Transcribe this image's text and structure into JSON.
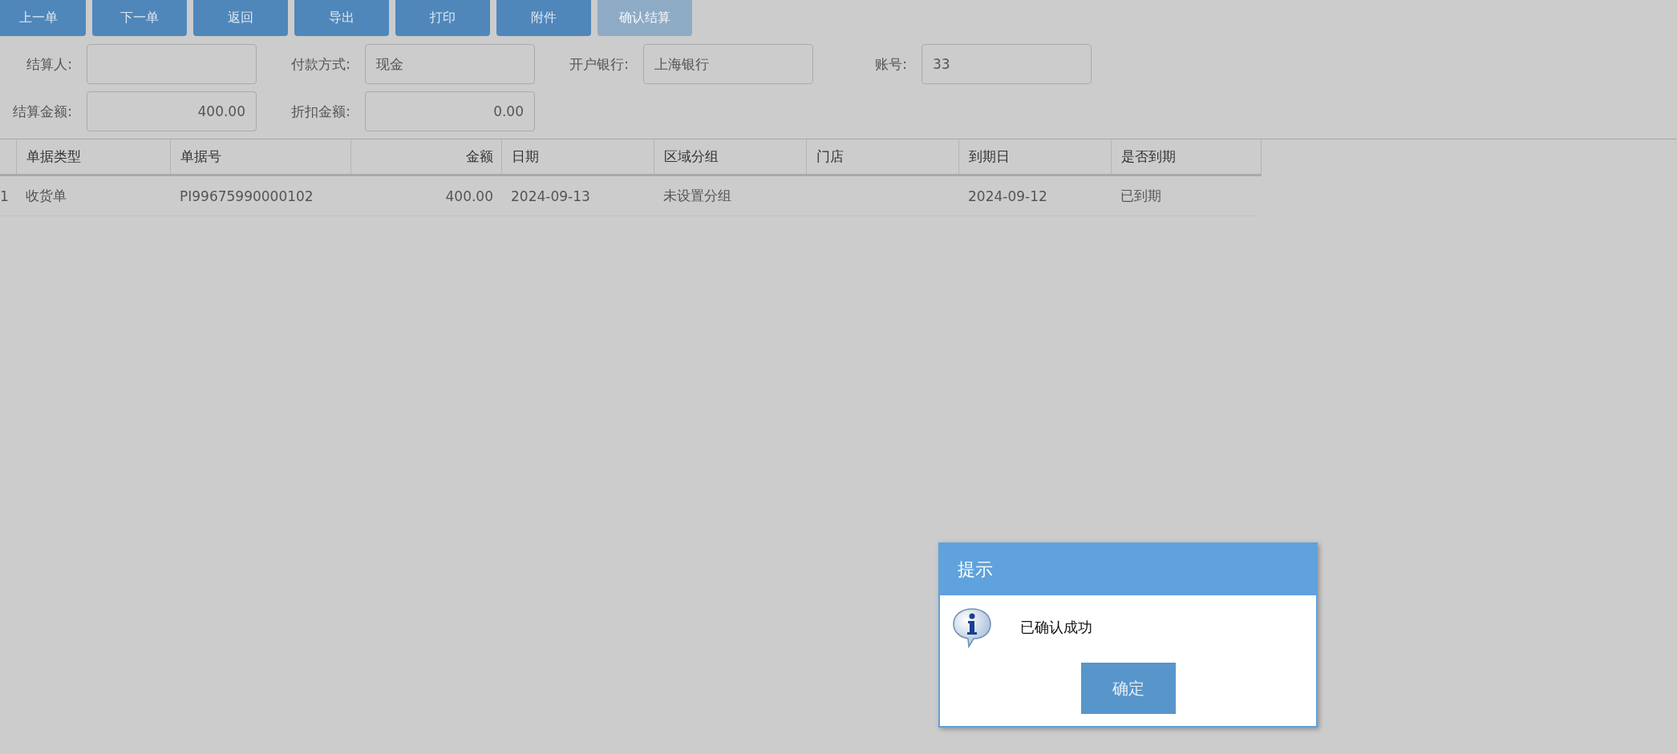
{
  "toolbar": [
    {
      "label": "上一单",
      "disabled": false
    },
    {
      "label": "下一单",
      "disabled": false
    },
    {
      "label": "返回",
      "disabled": false
    },
    {
      "label": "导出",
      "disabled": false
    },
    {
      "label": "打印",
      "disabled": false
    },
    {
      "label": "附件",
      "disabled": false
    },
    {
      "label": "确认结算",
      "disabled": true
    }
  ],
  "form_rows": [
    [
      {
        "label": "结算人:",
        "kind": "text"
      },
      {
        "label": "付款方式:",
        "value": "现金",
        "kind": "text"
      },
      {
        "label": "开户银行:",
        "value": "上海银行",
        "kind": "text"
      },
      {
        "label": "账号:",
        "value": "33",
        "kind": "text"
      }
    ],
    [
      {
        "label": "结算金额:",
        "value": "400.00",
        "kind": "amount"
      },
      {
        "label": "折扣金额:",
        "value": "0.00",
        "kind": "amount"
      }
    ]
  ],
  "table": {
    "columns": [
      {
        "kind": "index"
      },
      {
        "label": "单据类型",
        "kind": "text"
      },
      {
        "label": "单据号",
        "kind": "text"
      },
      {
        "label": "金额",
        "kind": "amount"
      },
      {
        "label": "日期",
        "kind": "text"
      },
      {
        "label": "区域分组",
        "kind": "text"
      },
      {
        "label": "门店",
        "kind": "text"
      },
      {
        "label": "到期日",
        "kind": "text"
      },
      {
        "label": "是否到期",
        "kind": "text"
      }
    ],
    "rows": [
      [
        "1",
        "收货单",
        "PI99675990000102",
        "400.00",
        "2024-09-13",
        "未设置分组",
        null,
        "2024-09-12",
        "已到期"
      ]
    ]
  },
  "dialog": {
    "title": "提示",
    "message": "已确认成功",
    "button": "确定"
  }
}
